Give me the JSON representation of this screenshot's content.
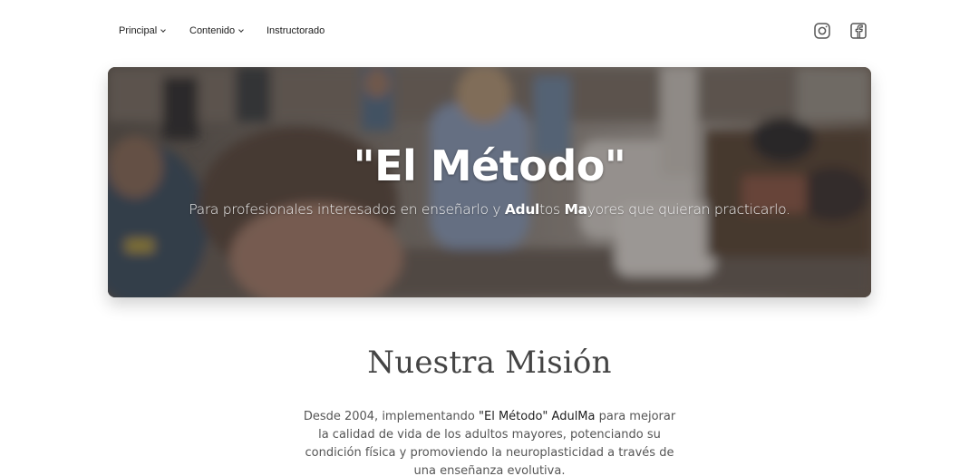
{
  "nav": {
    "items": [
      {
        "label": "Principal",
        "has_dropdown": true
      },
      {
        "label": "Contenido",
        "has_dropdown": true
      },
      {
        "label": "Instructorado",
        "has_dropdown": false
      }
    ],
    "social": {
      "instagram_icon": "instagram-icon",
      "facebook_icon": "facebook-icon"
    }
  },
  "hero": {
    "title": "\"El Método\"",
    "subtitle_parts": {
      "p1": "Para profesionales interesados en enseñarlo y ",
      "b1": "Adul",
      "p2": "tos ",
      "b2": "Ma",
      "p3": "yores que quieran practicarlo."
    }
  },
  "mission": {
    "title": "Nuestra Misión",
    "text_parts": {
      "t1": "Desde 2004, implementando ",
      "e1": "\"El Método\" AdulMa",
      "t2": " para mejorar la calidad de vida de los adultos mayores, potenciando su condición física y promoviendo la neuroplasticidad a través de una enseñanza evolutiva."
    }
  },
  "colors": {
    "text_dark": "#1c1c1c",
    "heading_gray": "#444444",
    "body_gray": "#555555",
    "hero_text": "#ffffff"
  }
}
